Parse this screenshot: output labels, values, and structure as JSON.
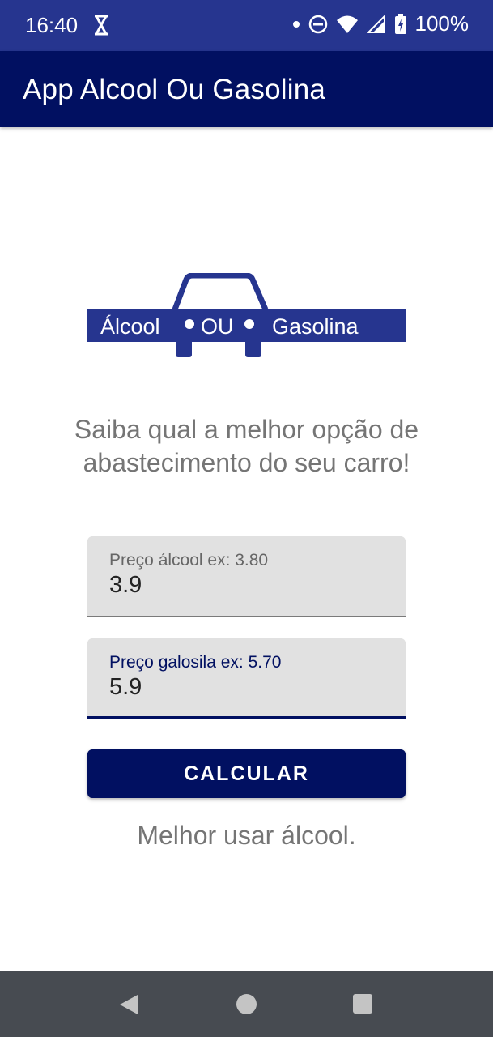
{
  "status_bar": {
    "time": "16:40",
    "battery": "100%",
    "icons": [
      "hourglass-icon",
      "notification-dot-icon",
      "do-not-disturb-icon",
      "wifi-icon",
      "signal-icon",
      "battery-charging-icon"
    ]
  },
  "app_bar": {
    "title": "App Alcool Ou Gasolina"
  },
  "logo": {
    "left": "Álcool",
    "middle": "OU",
    "right": "Gasolina",
    "color": "#26358f"
  },
  "headline": "Saiba qual a melhor opção de abastecimento do seu carro!",
  "fields": {
    "alcool": {
      "label": "Preço álcool ex: 3.80",
      "value": "3.9"
    },
    "gasolina": {
      "label": "Preço galosila ex: 5.70",
      "value": "5.9"
    }
  },
  "button": {
    "label": "CALCULAR"
  },
  "result": "Melhor usar álcool.",
  "nav_bar": {
    "icons": [
      "back-icon",
      "home-icon",
      "recents-icon"
    ]
  },
  "colors": {
    "primary": "#011061",
    "status_bar": "#26358f",
    "nav_bar": "#474b51"
  }
}
